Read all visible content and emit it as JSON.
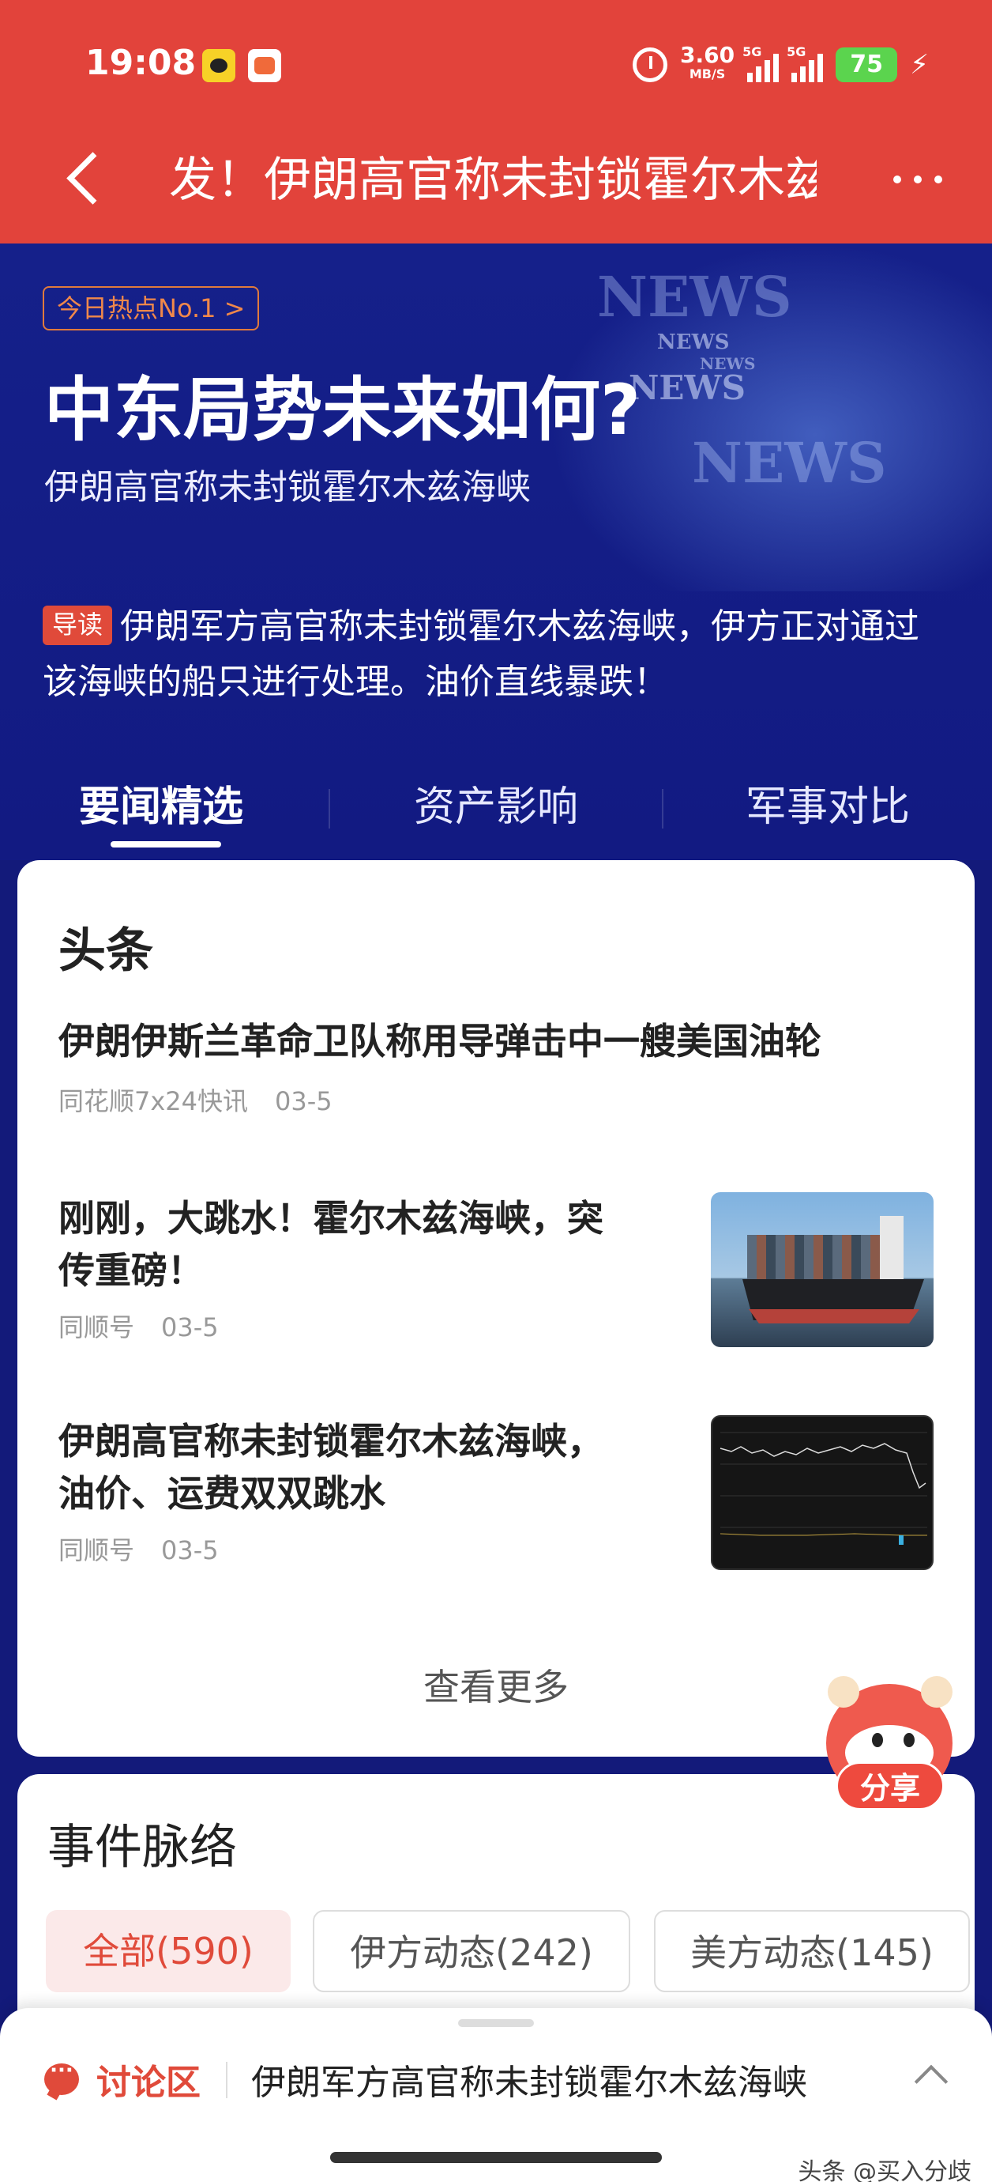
{
  "status_bar": {
    "time": "19:08",
    "net_speed": "3.60",
    "net_unit": "MB/S",
    "sig1_label": "5G",
    "sig2_label": "5G",
    "battery": "75"
  },
  "nav": {
    "title": "发！伊朗高官称未封锁霍尔木兹海峡"
  },
  "hero": {
    "hot_tag": "今日热点No.1 >",
    "title": "中东局势未来如何?",
    "subtitle": "伊朗高官称未封锁霍尔木兹海峡",
    "lead_badge": "导读",
    "lead_text": "伊朗军方高官称未封锁霍尔木兹海峡，伊方正对通过该海峡的船只进行处理。油价直线暴跌！",
    "bg_words": [
      "NEWS",
      "NEWS",
      "NEWS",
      "NEWS",
      "NEWS"
    ]
  },
  "tabs": [
    {
      "label": "要闻精选",
      "active": true
    },
    {
      "label": "资产影响",
      "active": false
    },
    {
      "label": "军事对比",
      "active": false
    }
  ],
  "headlines": {
    "title": "头条",
    "items": [
      {
        "title": "伊朗伊斯兰革命卫队称用导弹击中一艘美国油轮",
        "source": "同花顺7x24快讯",
        "date": "03-5"
      },
      {
        "title_line1": "刚刚，大跳水！霍尔木兹海峡，突",
        "title_line2": "传重磅！",
        "source": "同顺号",
        "date": "03-5",
        "thumb": "container-ship-image"
      },
      {
        "title_line1": "伊朗高官称未封锁霍尔木兹海峡，",
        "title_line2": "油价、运费双双跳水",
        "source": "同顺号",
        "date": "03-5",
        "thumb": "price-chart-image"
      }
    ],
    "more": "查看更多"
  },
  "timeline": {
    "title": "事件脉络",
    "chips": [
      {
        "label": "全部(590)",
        "active": true
      },
      {
        "label": "伊方动态(242)",
        "active": false
      },
      {
        "label": "美方动态(145)",
        "active": false
      }
    ]
  },
  "share": {
    "label": "分享"
  },
  "discussion": {
    "label": "讨论区",
    "text": "伊朗军方高官称未封锁霍尔木兹海峡"
  },
  "watermark": "头条 @买入分歧",
  "colors": {
    "primary_red": "#e2433b",
    "hero_blue": "#131a7a",
    "accent_orange": "#f0884a"
  }
}
